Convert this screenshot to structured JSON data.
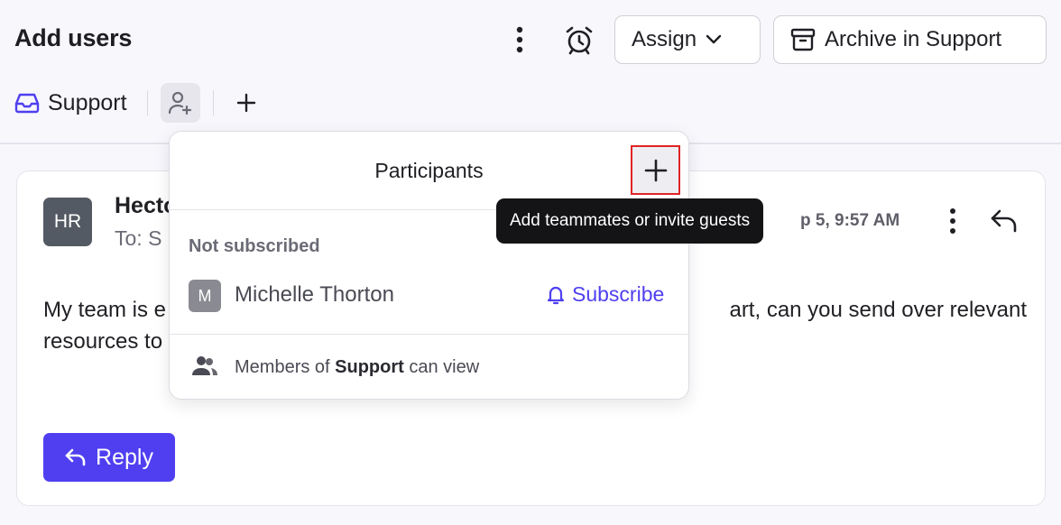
{
  "header": {
    "title": "Add users",
    "assign_label": "Assign",
    "archive_label": "Archive in Support"
  },
  "tabs": {
    "support_label": "Support"
  },
  "message": {
    "avatar_initials": "HR",
    "sender": "Hecto",
    "to": "To: S",
    "date": "p 5, 9:57 AM",
    "body_line1": "My team is e",
    "body_line1_right": "art, can you send over relevant",
    "body_line2": "resources to",
    "reply_label": "Reply"
  },
  "participants_popover": {
    "title": "Participants",
    "section_label": "Not subscribed",
    "member": {
      "initial": "M",
      "name": "Michelle Thorton"
    },
    "subscribe_label": "Subscribe",
    "members_prefix": "Members of",
    "members_team": "Support",
    "members_suffix": "can view"
  },
  "tooltip": {
    "text": "Add teammates or invite guests"
  },
  "colors": {
    "accent": "#4f3ff0",
    "highlight_border": "#e02424",
    "tooltip_bg": "#141417",
    "avatar_hr_bg": "#545a63"
  }
}
